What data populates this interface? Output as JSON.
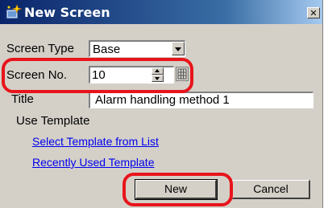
{
  "dialog": {
    "title": "New Screen",
    "close_glyph": "✕",
    "title_icon": "new-screen-sparkle-icon"
  },
  "fields": {
    "screen_type_label": "Screen Type",
    "screen_type_value": "Base",
    "screen_no_label": "Screen No.",
    "screen_no_value": "10",
    "title_label": "Title",
    "title_value": "Alarm handling method 1"
  },
  "template": {
    "group_label": "Use Template",
    "select_link": "Select Template from List",
    "recent_link": "Recently Used Template"
  },
  "buttons": {
    "new_label": "New",
    "cancel_label": "Cancel"
  },
  "colors": {
    "highlight_ring": "#e8141b",
    "link": "#0000ee",
    "titlebar": "#0a246a"
  }
}
